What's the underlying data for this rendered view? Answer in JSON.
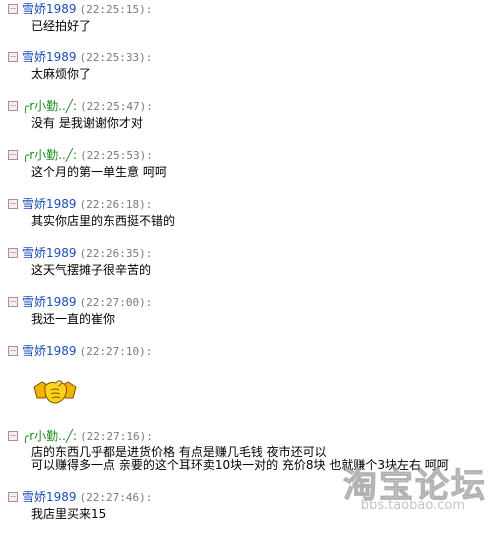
{
  "messages": [
    {
      "sender": "雪娇1989",
      "role": "me",
      "time": "(22:25:15):",
      "text": "已经拍好了"
    },
    {
      "sender": "雪娇1989",
      "role": "me",
      "time": "(22:25:33):",
      "text": "太麻烦你了"
    },
    {
      "sender": "╭r小勤..╱:",
      "role": "other",
      "time": "(22:25:47):",
      "text": "没有 是我谢谢你才对"
    },
    {
      "sender": "╭r小勤..╱:",
      "role": "other",
      "time": "(22:25:53):",
      "text": "这个月的第一单生意 呵呵"
    },
    {
      "sender": "雪娇1989",
      "role": "me",
      "time": "(22:26:18):",
      "text": "其实你店里的东西挺不错的"
    },
    {
      "sender": "雪娇1989",
      "role": "me",
      "time": "(22:26:35):",
      "text": "这天气摆摊子很辛苦的"
    },
    {
      "sender": "雪娇1989",
      "role": "me",
      "time": "(22:27:00):",
      "text": "我还一直的崔你"
    },
    {
      "sender": "雪娇1989",
      "role": "me",
      "time": "(22:27:10):",
      "emoticon": "handshake-emoticon"
    },
    {
      "sender": "╭r小勤..╱:",
      "role": "other",
      "time": "(22:27:16):",
      "lines": [
        "店的东西几乎都是进货价格 有点是赚几毛钱 夜市还可以",
        "可以赚得多一点 亲要的这个耳环卖10块一对的 充价8块 也就赚个3块左右 呵呵"
      ]
    },
    {
      "sender": "雪娇1989",
      "role": "me",
      "time": "(22:27:46):",
      "text": "我店里买来15"
    }
  ],
  "watermark": {
    "logo": "淘宝论坛",
    "url": "bbs.taobao.com"
  },
  "colors": {
    "me_sender": "#1a4fb8",
    "other_sender": "#1c8a1c",
    "timestamp": "#7a7a7a"
  }
}
